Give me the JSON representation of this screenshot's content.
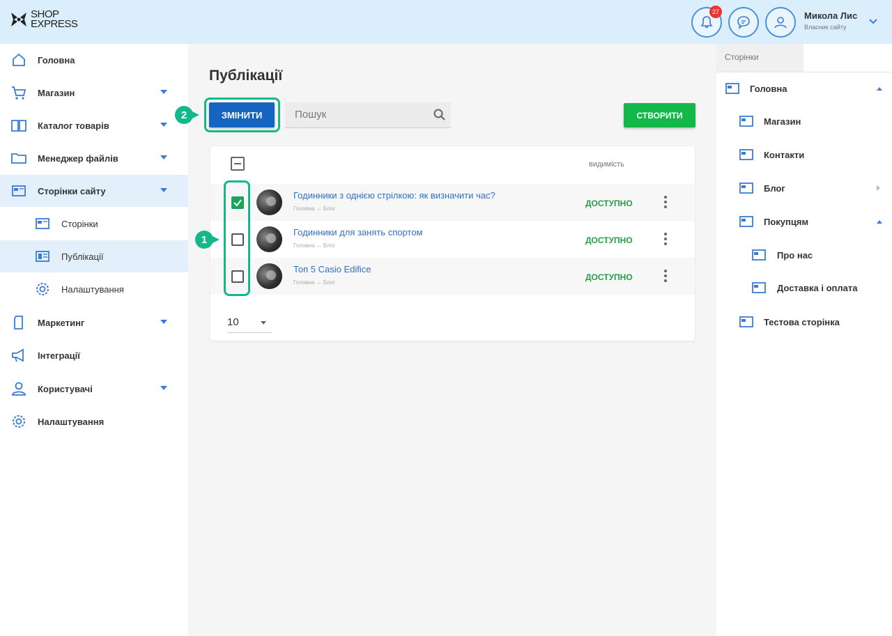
{
  "header": {
    "logo_line1": "SHOP",
    "logo_line2": "EXPRESS",
    "notification_count": "27",
    "user_name": "Микола Лис",
    "user_role": "Власник сайту"
  },
  "sidebar": {
    "items": [
      {
        "label": "Головна",
        "icon": "home-icon"
      },
      {
        "label": "Магазин",
        "icon": "cart-icon"
      },
      {
        "label": "Каталог товарів",
        "icon": "book-icon"
      },
      {
        "label": "Менеджер файлів",
        "icon": "folder-icon"
      },
      {
        "label": "Сторінки сайту",
        "icon": "pages-icon"
      },
      {
        "label": "Сторінки",
        "icon": "page-icon"
      },
      {
        "label": "Публікації",
        "icon": "publications-icon"
      },
      {
        "label": "Налаштування",
        "icon": "gear-icon"
      },
      {
        "label": "Маркетинг",
        "icon": "marketing-icon"
      },
      {
        "label": "Інтеграції",
        "icon": "megaphone-icon"
      },
      {
        "label": "Користувачі",
        "icon": "user-icon"
      },
      {
        "label": "Налаштування",
        "icon": "gear-icon"
      }
    ]
  },
  "main": {
    "title": "Публікації",
    "edit_label": "ЗМІНИТИ",
    "search_placeholder": "Пошук",
    "create_label": "СТВОРИТИ",
    "col_visibility": "видимість",
    "rows": [
      {
        "title": "Годинники з однією стрілкою: як визначити час?",
        "path": "Головна → Блог",
        "status": "ДОСТУПНО",
        "checked": true
      },
      {
        "title": "Годинники для занять спортом",
        "path": "Головна → Блог",
        "status": "ДОСТУПНО",
        "checked": false
      },
      {
        "title": "Топ 5 Casio Edifice",
        "path": "Головна → Блог",
        "status": "ДОСТУПНО",
        "checked": false
      }
    ],
    "per_page": "10"
  },
  "annotations": {
    "step1": "1",
    "step2": "2"
  },
  "right_panel": {
    "tab": "Сторінки",
    "tree": [
      {
        "label": "Головна"
      },
      {
        "label": "Магазин"
      },
      {
        "label": "Контакти"
      },
      {
        "label": "Блог"
      },
      {
        "label": "Покупцям"
      },
      {
        "label": "Про нас"
      },
      {
        "label": "Доставка і оплата"
      },
      {
        "label": "Тестова сторінка"
      }
    ]
  },
  "colors": {
    "header_bg": "#dbeefb",
    "primary_blue": "#1565c0",
    "create_green": "#14b84a",
    "annotation_teal": "#14b88a",
    "status_green": "#26a047"
  }
}
